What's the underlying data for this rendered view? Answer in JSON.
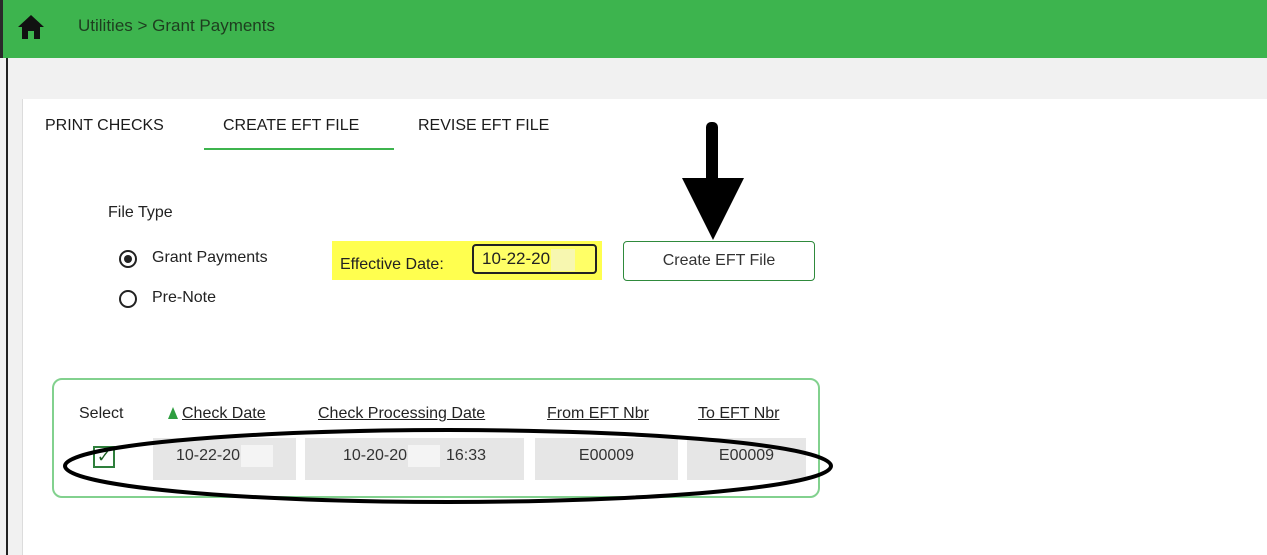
{
  "breadcrumb": "Utilities > Grant Payments",
  "tabs": [
    {
      "label": "PRINT CHECKS"
    },
    {
      "label": "CREATE EFT FILE"
    },
    {
      "label": "REVISE EFT FILE"
    }
  ],
  "file_type": {
    "label": "File Type",
    "options": [
      {
        "label": "Grant Payments",
        "selected": true
      },
      {
        "label": "Pre-Note",
        "selected": false
      }
    ]
  },
  "effective_date": {
    "label": "Effective Date:",
    "value": "10-22-20"
  },
  "create_button": "Create EFT File",
  "table": {
    "headers": [
      "Select",
      "Check Date",
      "Check Processing Date",
      "From EFT Nbr",
      "To EFT Nbr"
    ],
    "sort_column": "Check Date",
    "rows": [
      {
        "selected": true,
        "check_date": "10-22-20",
        "processing_date": "10-20-20",
        "processing_time": "16:33",
        "from_eft": "E00009",
        "to_eft": "E00009"
      }
    ]
  },
  "colors": {
    "header_green": "#3db44e",
    "highlight_yellow": "#ffff4f"
  }
}
